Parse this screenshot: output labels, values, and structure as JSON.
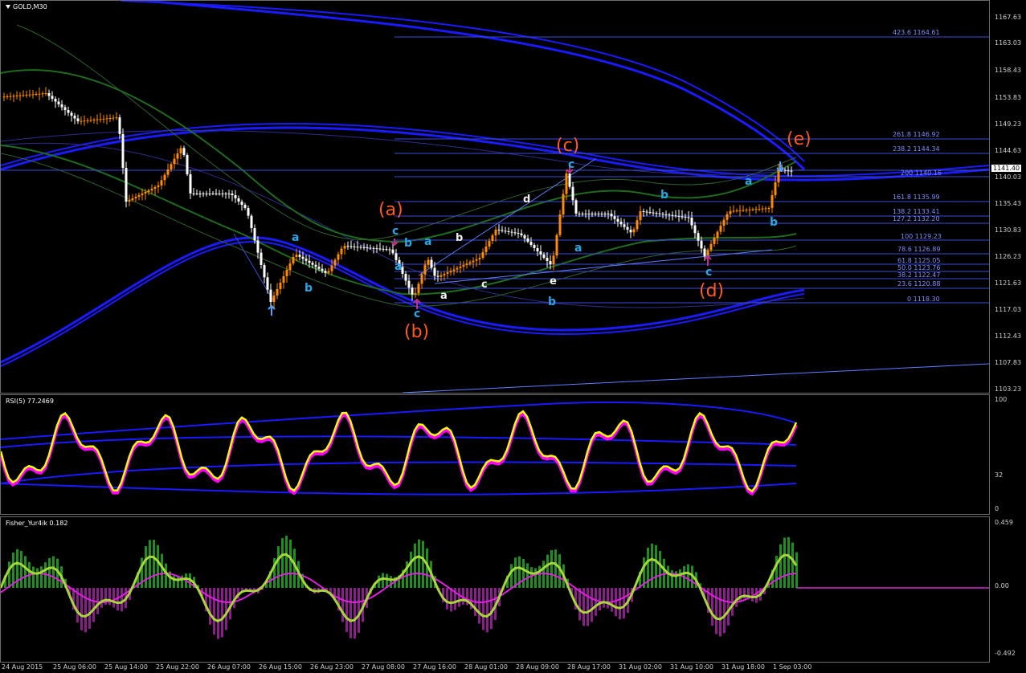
{
  "main": {
    "title": "GOLD,M30",
    "price_current": "1141.40",
    "price_axis": [
      "1167.63",
      "1163.03",
      "1158.43",
      "1153.83",
      "1149.23",
      "1144.63",
      "1140.03",
      "1135.43",
      "1130.83",
      "1126.23",
      "1121.63",
      "1117.03",
      "1112.43",
      "1107.83",
      "1103.23"
    ],
    "fib_levels": [
      {
        "label": "423.6 1164.61"
      },
      {
        "label": "261.8 1146.92"
      },
      {
        "label": "238.2 1144.34"
      },
      {
        "label": "200 1140.16"
      },
      {
        "label": "161.8 1135.99"
      },
      {
        "label": "138.2 1133.41"
      },
      {
        "label": "127.2 1132.20"
      },
      {
        "label": "100 1129.23"
      },
      {
        "label": "78.6 1126.89"
      },
      {
        "label": "61.8 1125.05"
      },
      {
        "label": "50.0 1123.76"
      },
      {
        "label": "38.2 1122.47"
      },
      {
        "label": "23.6 1120.88"
      },
      {
        "label": "0 1118.30"
      }
    ],
    "wave_labels": {
      "big_a": "(a)",
      "big_b": "(b)",
      "big_c": "(c)",
      "big_d": "(d)",
      "big_e": "(e)",
      "a1": "a",
      "b1": "b",
      "c1": "c",
      "c2": "c",
      "b2": "b",
      "a2": "a",
      "a3": "a",
      "c3": "c",
      "w_a": "a",
      "w_b": "b",
      "w_c": "c",
      "w_d": "d",
      "w_e": "e",
      "c4": "c",
      "a4": "a",
      "b3": "b",
      "b4": "b",
      "c5": "c",
      "a5": "a",
      "b5": "b"
    }
  },
  "rsi": {
    "title": "RSI(5) 77.2469",
    "axis": [
      "100",
      "32",
      "0"
    ]
  },
  "fisher": {
    "title": "Fisher_Yur4ik 0.182",
    "axis": [
      "0.459",
      "0.00",
      "-0.492"
    ]
  },
  "time_axis": [
    "24 Aug 2015",
    "25 Aug 06:00",
    "25 Aug 14:00",
    "25 Aug 22:00",
    "26 Aug 07:00",
    "26 Aug 15:00",
    "26 Aug 23:00",
    "27 Aug 08:00",
    "27 Aug 16:00",
    "28 Aug 01:00",
    "28 Aug 09:00",
    "28 Aug 17:00",
    "31 Aug 02:00",
    "31 Aug 10:00",
    "31 Aug 18:00",
    "1 Sep 03:00"
  ],
  "colors": {
    "bull": "#ff8c00",
    "bear": "#ffffff",
    "band": "#1f1fff",
    "fib": "#3a4bd8",
    "rsi": "#ffff00",
    "fisher_pos": "#1f8f1f",
    "fisher_neg": "#8a1f8a"
  }
}
